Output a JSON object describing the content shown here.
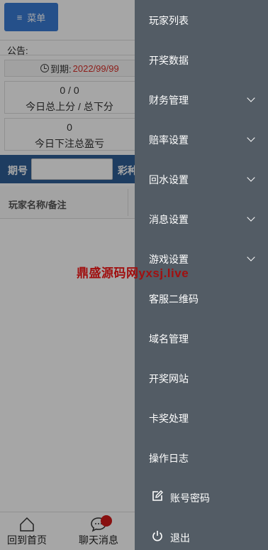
{
  "header": {
    "menu_label": "菜单",
    "menu_icon": "hamburger-icon"
  },
  "notice": {
    "label": "公告:"
  },
  "expire": {
    "label": "到期:",
    "date": "2022/99/99",
    "icon": "clock-icon",
    "date_color": "#d9302a"
  },
  "stats": [
    {
      "value": "0 / 0",
      "label": "今日总上分 / 总下分"
    },
    {
      "value": "0",
      "label": "今日下注总盈亏"
    }
  ],
  "search": {
    "period_label": "期号",
    "period_placeholder": "",
    "lottery_label": "彩种"
  },
  "table": {
    "col_player": "玩家名称/备注"
  },
  "bottom_nav": {
    "home_label": "回到首页",
    "home_icon": "home-icon",
    "chat_label": "聊天消息",
    "chat_icon": "chat-bubble-icon"
  },
  "drawer": {
    "items": [
      {
        "label": "玩家列表",
        "expandable": false
      },
      {
        "label": "开奖数据",
        "expandable": false
      },
      {
        "label": "财务管理",
        "expandable": true
      },
      {
        "label": "赔率设置",
        "expandable": true
      },
      {
        "label": "回水设置",
        "expandable": true
      },
      {
        "label": "消息设置",
        "expandable": true
      },
      {
        "label": "游戏设置",
        "expandable": true
      },
      {
        "label": "客服二维码",
        "expandable": false
      },
      {
        "label": "域名管理",
        "expandable": false
      },
      {
        "label": "开奖网站",
        "expandable": false
      },
      {
        "label": "卡奖处理",
        "expandable": false
      },
      {
        "label": "操作日志",
        "expandable": false
      },
      {
        "label": "账号密码",
        "expandable": false,
        "icon": "edit-icon"
      },
      {
        "label": "退出",
        "expandable": false,
        "icon": "power-icon"
      }
    ],
    "background": "#535c65"
  },
  "watermark": {
    "text": "鼎盛源码网yxsj.live",
    "color": "#a01010"
  },
  "colors": {
    "menu_button": "#3a7bd5",
    "search_bar": "#2f5f95",
    "badge": "#d11a1a"
  }
}
